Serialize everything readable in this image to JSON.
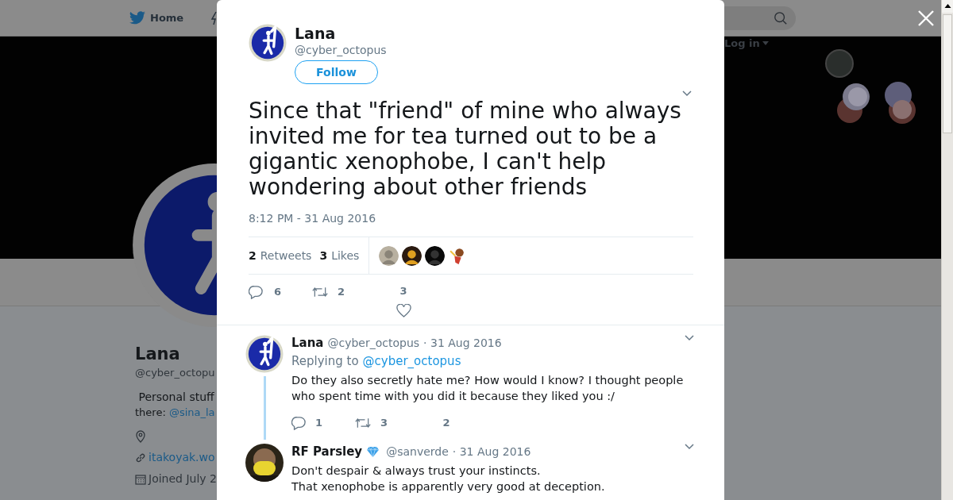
{
  "page": {
    "nav_home": "Home",
    "login": "Log in",
    "profile": {
      "name": "Lana",
      "handle": "@cyber_octopu",
      "bio_line1": " Personal stuff",
      "bio_prefix": "there: ",
      "bio_link": "@sina_la",
      "website": "itakoyak.wo",
      "joined": "Joined July 2"
    }
  },
  "modal": {
    "tweet": {
      "name": "Lana",
      "handle": "@cyber_octopus",
      "follow": "Follow",
      "text": "Since that \"friend\" of mine who always invited me for tea turned out to be a gigantic xenophobe, I can't help wondering about other friends",
      "time": "8:12 PM - 31 Aug 2016",
      "retweets_count": "2",
      "retweets_label": "Retweets",
      "likes_count": "3",
      "likes_label": "Likes",
      "replies": "6",
      "retweets": "2",
      "likes": "3"
    },
    "replies": [
      {
        "avatar": {
          "kind": "sign"
        },
        "name": "Lana",
        "verified": false,
        "handle": "@cyber_octopus",
        "date": "· 31 Aug 2016",
        "replying_prefix": "Replying to",
        "replying_link": "@cyber_octopus",
        "lines": [
          "Do they also secretly hate me? How would I know? I thought people who spent time with you did it because they liked you :/"
        ],
        "replies": "1",
        "retweets": "3",
        "likes": "2"
      },
      {
        "name": "RF Parsley",
        "verified": true,
        "handle": "@sanverde",
        "date": "· 31 Aug 2016",
        "lines": [
          "Don't despair & always trust your instincts.",
          "That xenophobe is apparently very good at deception."
        ]
      }
    ]
  }
}
